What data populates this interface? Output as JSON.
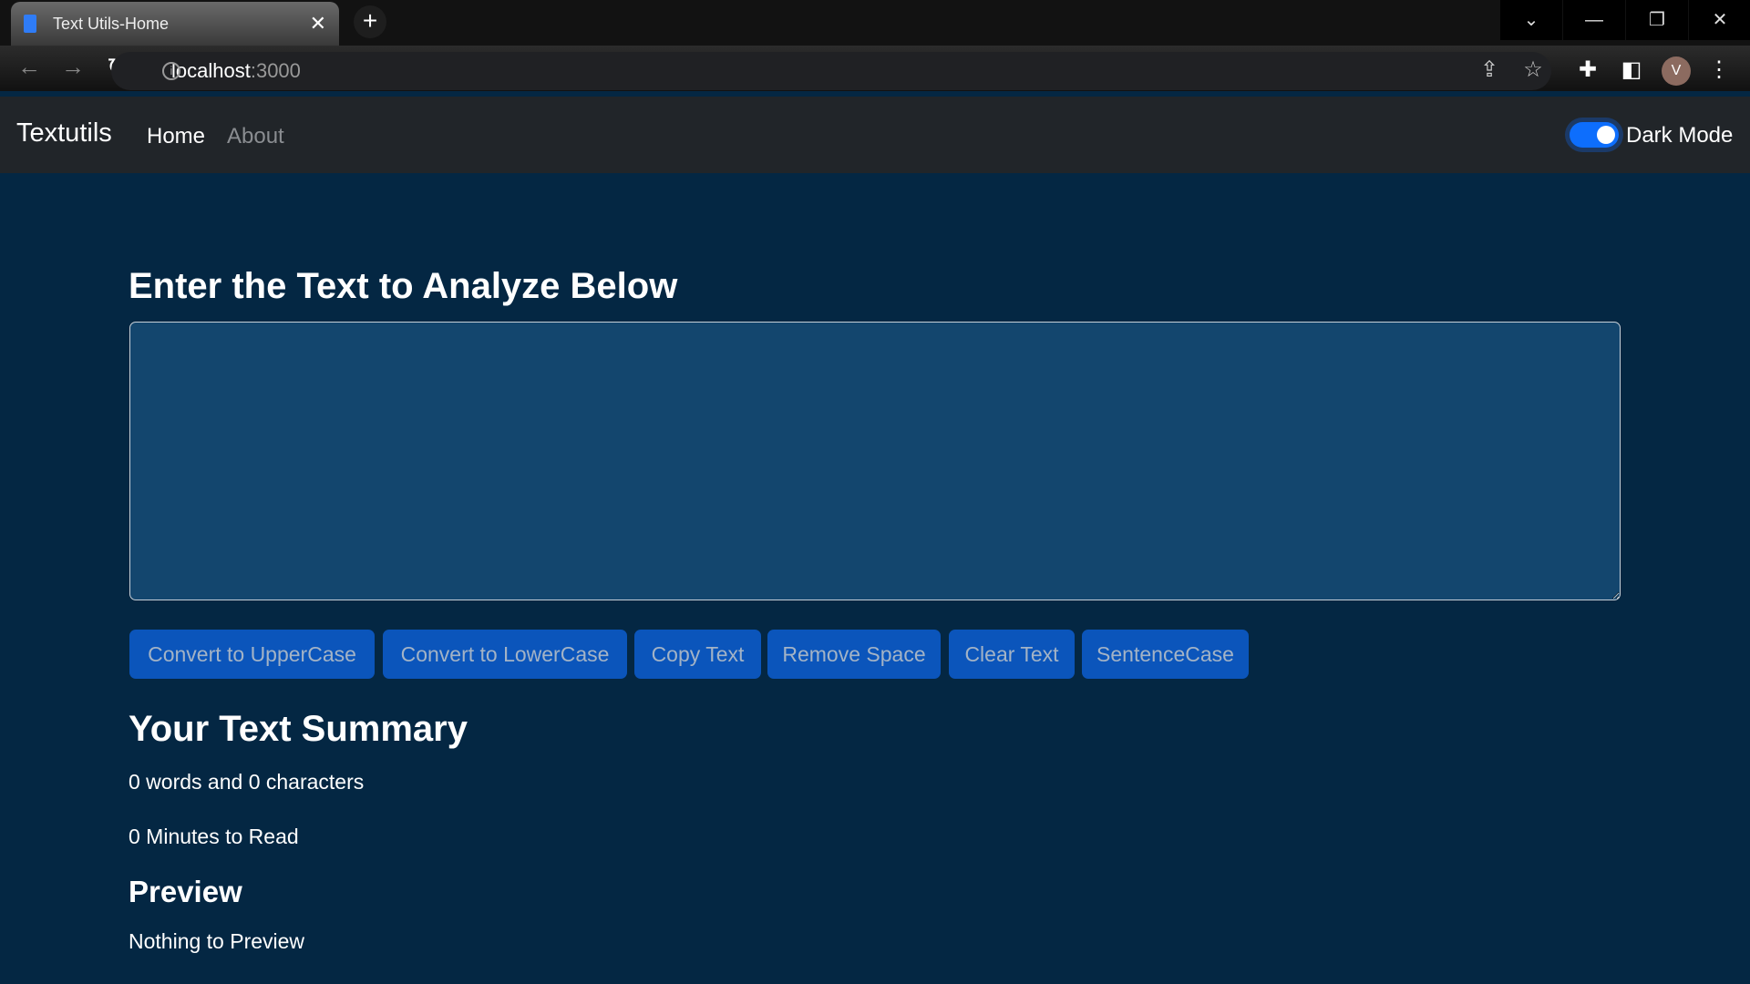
{
  "browser": {
    "tab_title": "Text Utils-Home",
    "url_host": "localhost",
    "url_port": ":3000",
    "avatar_initial": "V"
  },
  "navbar": {
    "brand": "Textutils",
    "links": [
      "Home",
      "About"
    ],
    "dark_mode_label": "Dark Mode",
    "dark_mode_on": true
  },
  "main": {
    "heading": "Enter the Text to Analyze Below",
    "textarea_value": "",
    "buttons": [
      "Convert to UpperCase",
      "Convert to LowerCase",
      "Copy Text",
      "Remove Space",
      "Clear Text",
      "SentenceCase"
    ],
    "summary_heading": "Your Text Summary",
    "word_char_count": "0 words and 0 characters",
    "read_time": "0 Minutes to Read",
    "preview_heading": "Preview",
    "preview_text": "Nothing to Preview"
  },
  "colors": {
    "body_bg": "#042743",
    "textarea_bg": "#13466e",
    "button_bg": "#0b55bb",
    "navbar_bg": "#212529"
  }
}
